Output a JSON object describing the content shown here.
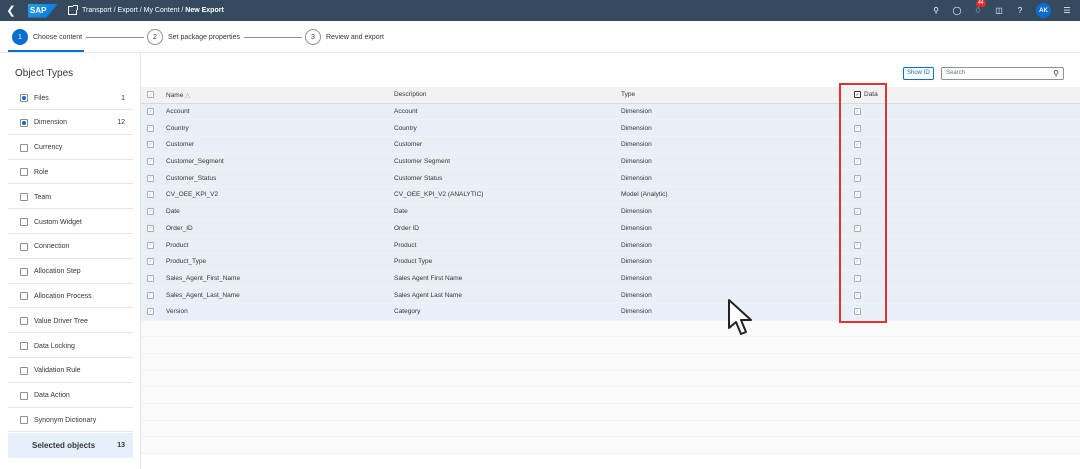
{
  "shell": {
    "logo": "SAP",
    "breadcrumb": [
      "Transport",
      "Export",
      "My Content"
    ],
    "current": "New Export",
    "notification_count": "44",
    "user_initials": "AK"
  },
  "wizard": {
    "steps": [
      {
        "num": "1",
        "label": "Choose content"
      },
      {
        "num": "2",
        "label": "Set package properties"
      },
      {
        "num": "3",
        "label": "Review and export"
      }
    ]
  },
  "object_types": {
    "title": "Object Types",
    "items": [
      {
        "label": "Files",
        "count": "1",
        "checked": true
      },
      {
        "label": "Dimension",
        "count": "12",
        "checked": true
      },
      {
        "label": "Currency",
        "count": "",
        "checked": false
      },
      {
        "label": "Role",
        "count": "",
        "checked": false
      },
      {
        "label": "Team",
        "count": "",
        "checked": false
      },
      {
        "label": "Custom Widget",
        "count": "",
        "checked": false
      },
      {
        "label": "Connection",
        "count": "",
        "checked": false
      },
      {
        "label": "Allocation Step",
        "count": "",
        "checked": false
      },
      {
        "label": "Allocation Process",
        "count": "",
        "checked": false
      },
      {
        "label": "Value Driver Tree",
        "count": "",
        "checked": false
      },
      {
        "label": "Data Locking",
        "count": "",
        "checked": false
      },
      {
        "label": "Validation Rule",
        "count": "",
        "checked": false
      },
      {
        "label": "Data Action",
        "count": "",
        "checked": false
      },
      {
        "label": "Synonym Dictionary",
        "count": "",
        "checked": false
      }
    ],
    "selected_label": "Selected objects",
    "selected_count": "13"
  },
  "toolbar": {
    "show_id": "Show ID",
    "search_placeholder": "Search"
  },
  "table": {
    "headers": {
      "name": "Name",
      "description": "Description",
      "type": "Type",
      "data": "Data"
    },
    "rows": [
      {
        "name": "Account",
        "description": "Account",
        "type": "Dimension"
      },
      {
        "name": "Country",
        "description": "Country",
        "type": "Dimension"
      },
      {
        "name": "Customer",
        "description": "Customer",
        "type": "Dimension"
      },
      {
        "name": "Customer_Segment",
        "description": "Customer Segment",
        "type": "Dimension"
      },
      {
        "name": "Customer_Status",
        "description": "Customer Status",
        "type": "Dimension"
      },
      {
        "name": "CV_OEE_KPI_V2",
        "description": "CV_OEE_KPI_V2 (ANALYTIC)",
        "type": "Model (Analytic)"
      },
      {
        "name": "Date",
        "description": "Date",
        "type": "Dimension"
      },
      {
        "name": "Order_ID",
        "description": "Order ID",
        "type": "Dimension"
      },
      {
        "name": "Product",
        "description": "Product",
        "type": "Dimension"
      },
      {
        "name": "Product_Type",
        "description": "Product Type",
        "type": "Dimension"
      },
      {
        "name": "Sales_Agent_First_Name",
        "description": "Sales Agent First Name",
        "type": "Dimension"
      },
      {
        "name": "Sales_Agent_Last_Name",
        "description": "Sales Agent Last Name",
        "type": "Dimension"
      },
      {
        "name": "Version",
        "description": "Category",
        "type": "Dimension"
      }
    ]
  }
}
